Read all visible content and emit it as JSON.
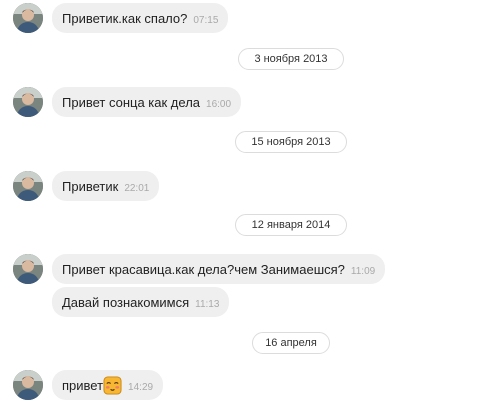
{
  "messages": [
    {
      "text": "Приветик.как спало?",
      "time": "07:15"
    },
    {
      "text": "Привет сонца как дела",
      "time": "16:00"
    },
    {
      "text": "Приветик",
      "time": "22:01"
    },
    {
      "text": "Привет красавица.как дела?чем Занимаешся?",
      "time": "11:09"
    },
    {
      "text": "Давай познакомимся",
      "time": "11:13"
    },
    {
      "text": "привет",
      "time": "14:29",
      "emoji": "blushing-face-icon"
    }
  ],
  "dates": [
    {
      "label": "3 ноября 2013"
    },
    {
      "label": "15 ноября 2013"
    },
    {
      "label": "12 января 2014"
    },
    {
      "label": "16 апреля"
    }
  ],
  "colors": {
    "bubble": "#efefef",
    "time": "#a9a9a9",
    "date_border": "#dcdcdc"
  }
}
